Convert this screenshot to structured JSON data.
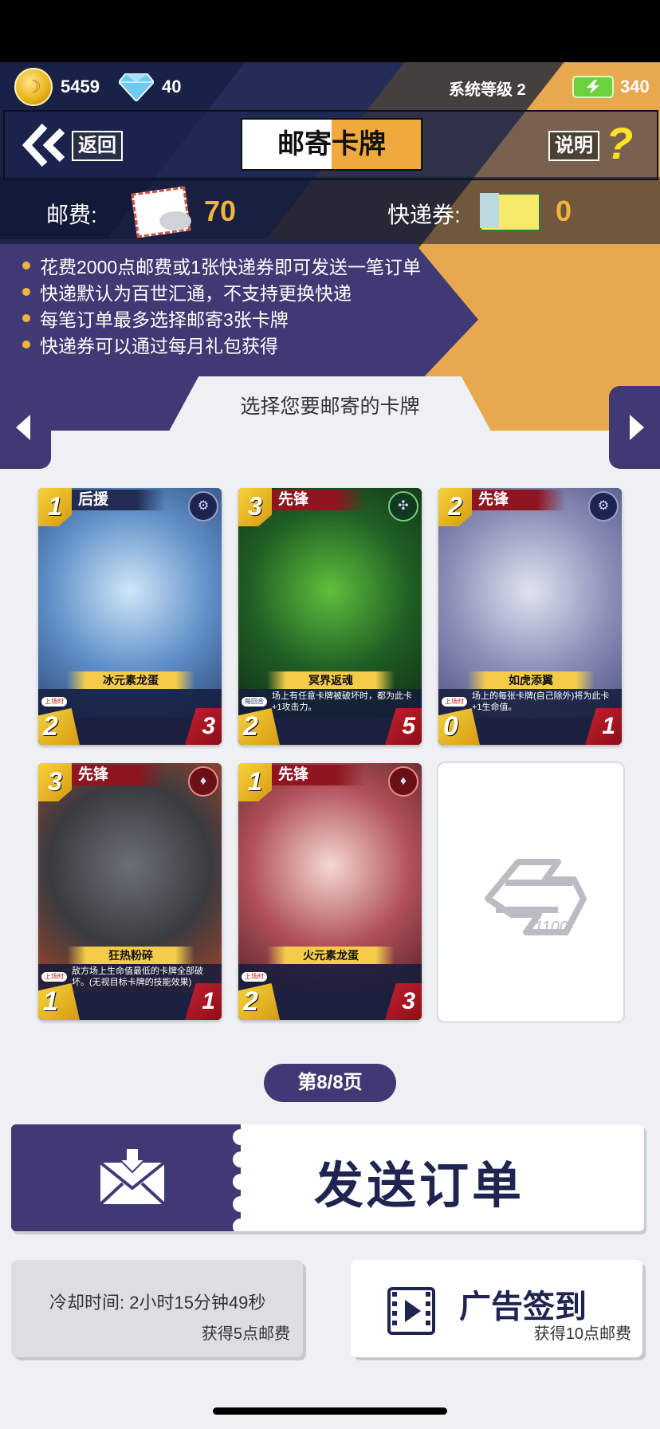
{
  "status_bar": {},
  "resources": {
    "coins": "5459",
    "diamonds": "40",
    "system_level": "系统等级 2",
    "energy": "340"
  },
  "nav": {
    "back_label": "返回",
    "title_left": "邮寄",
    "title_right": "卡牌",
    "help_label": "说明",
    "help_symbol": "?"
  },
  "postage": {
    "label": "邮费:",
    "value": "70"
  },
  "express": {
    "label": "快递券:",
    "value": "0"
  },
  "info_items": [
    "花费2000点邮费或1张快递券即可发送一笔订单",
    "快递默认为百世汇通，不支持更换快递",
    "每笔订单最多选择邮寄3张卡牌",
    "快递券可以通过每月礼包获得"
  ],
  "select_tab": "选择您要邮寄的卡牌",
  "cards": [
    {
      "cost": "1",
      "role": "后援",
      "role_color": "blue",
      "faction_icon": "gear-faction-icon",
      "name": "冰元素龙蛋",
      "tag": "上场时",
      "desc": "",
      "attack": "2",
      "health": "3",
      "art": [
        "#cfe6f7",
        "#5e8fc7",
        "#20345f"
      ]
    },
    {
      "cost": "3",
      "role": "先锋",
      "role_color": "red",
      "faction_icon": "triskelion-faction-icon",
      "name": "冥界返魂",
      "tag": "每回合",
      "desc": "场上有任意卡牌被破坏时，都为此卡+1攻击力。",
      "attack": "2",
      "health": "5",
      "art": [
        "#5fbf3c",
        "#1f5e24",
        "#0c1f12"
      ]
    },
    {
      "cost": "2",
      "role": "先锋",
      "role_color": "red",
      "faction_icon": "gear-faction-icon",
      "name": "如虎添翼",
      "tag": "上场时",
      "desc": "场上的每张卡牌(自己除外)将为此卡+1生命值。",
      "attack": "0",
      "health": "1",
      "art": [
        "#dfe3ef",
        "#8b8fb8",
        "#3b3f6e"
      ]
    },
    {
      "cost": "3",
      "role": "先锋",
      "role_color": "red",
      "faction_icon": "fire-faction-icon",
      "name": "狂热粉碎",
      "tag": "上场时",
      "desc": "敌方场上生命值最低的卡牌全部破坏。(无视目标卡牌的技能效果)",
      "attack": "1",
      "health": "1",
      "art": [
        "#6b6f78",
        "#3a3b40",
        "#c9461f"
      ]
    },
    {
      "cost": "1",
      "role": "先锋",
      "role_color": "red",
      "faction_icon": "fire-faction-icon",
      "name": "火元素龙蛋",
      "tag": "上场时",
      "desc": "",
      "attack": "2",
      "health": "3",
      "art": [
        "#f5d8d0",
        "#b0505a",
        "#3a1418"
      ]
    }
  ],
  "empty_slot_logo": "empty-slot-logo",
  "page_indicator": "第8/8页",
  "send_order": "发送订单",
  "cooldown": {
    "text": "冷却时间: 2小时15分钟49秒",
    "reward": "获得5点邮费"
  },
  "ad_signin": {
    "title": "广告签到",
    "reward": "获得10点邮费"
  },
  "colors": {
    "accent_purple": "#3f3a74",
    "accent_orange": "#f0a93c",
    "navy": "#1f2450",
    "gold_text": "#f2b53c"
  }
}
